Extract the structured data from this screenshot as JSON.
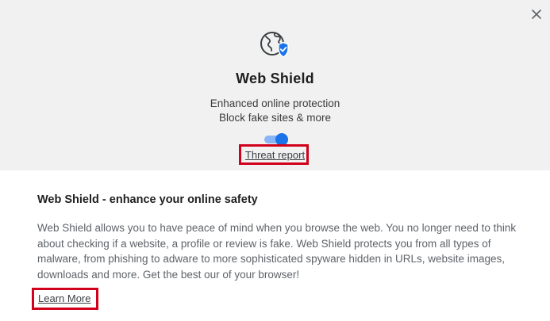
{
  "panel": {
    "title": "Web Shield",
    "subtitle_line1": "Enhanced online protection",
    "subtitle_line2": "Block fake sites & more",
    "toggle_state": "on",
    "threat_report_label": "Threat report",
    "icon": "globe-shield-check-icon",
    "close_icon": "close-icon"
  },
  "info": {
    "heading": "Web Shield - enhance your online safety",
    "body": "Web Shield allows you to have peace of mind when you browse the web. You no longer need to think about checking if a website, a profile or review is fake. Web Shield protects you from all types of malware, from phishing to adware to more sophisticated spyware hidden in URLs, website images, downloads and more. Get the best our of your browser!",
    "learn_more_label": "Learn More"
  },
  "colors": {
    "accent": "#1a73e8",
    "highlight_box": "#d0021b",
    "panel_bg": "#f1f1f1"
  }
}
